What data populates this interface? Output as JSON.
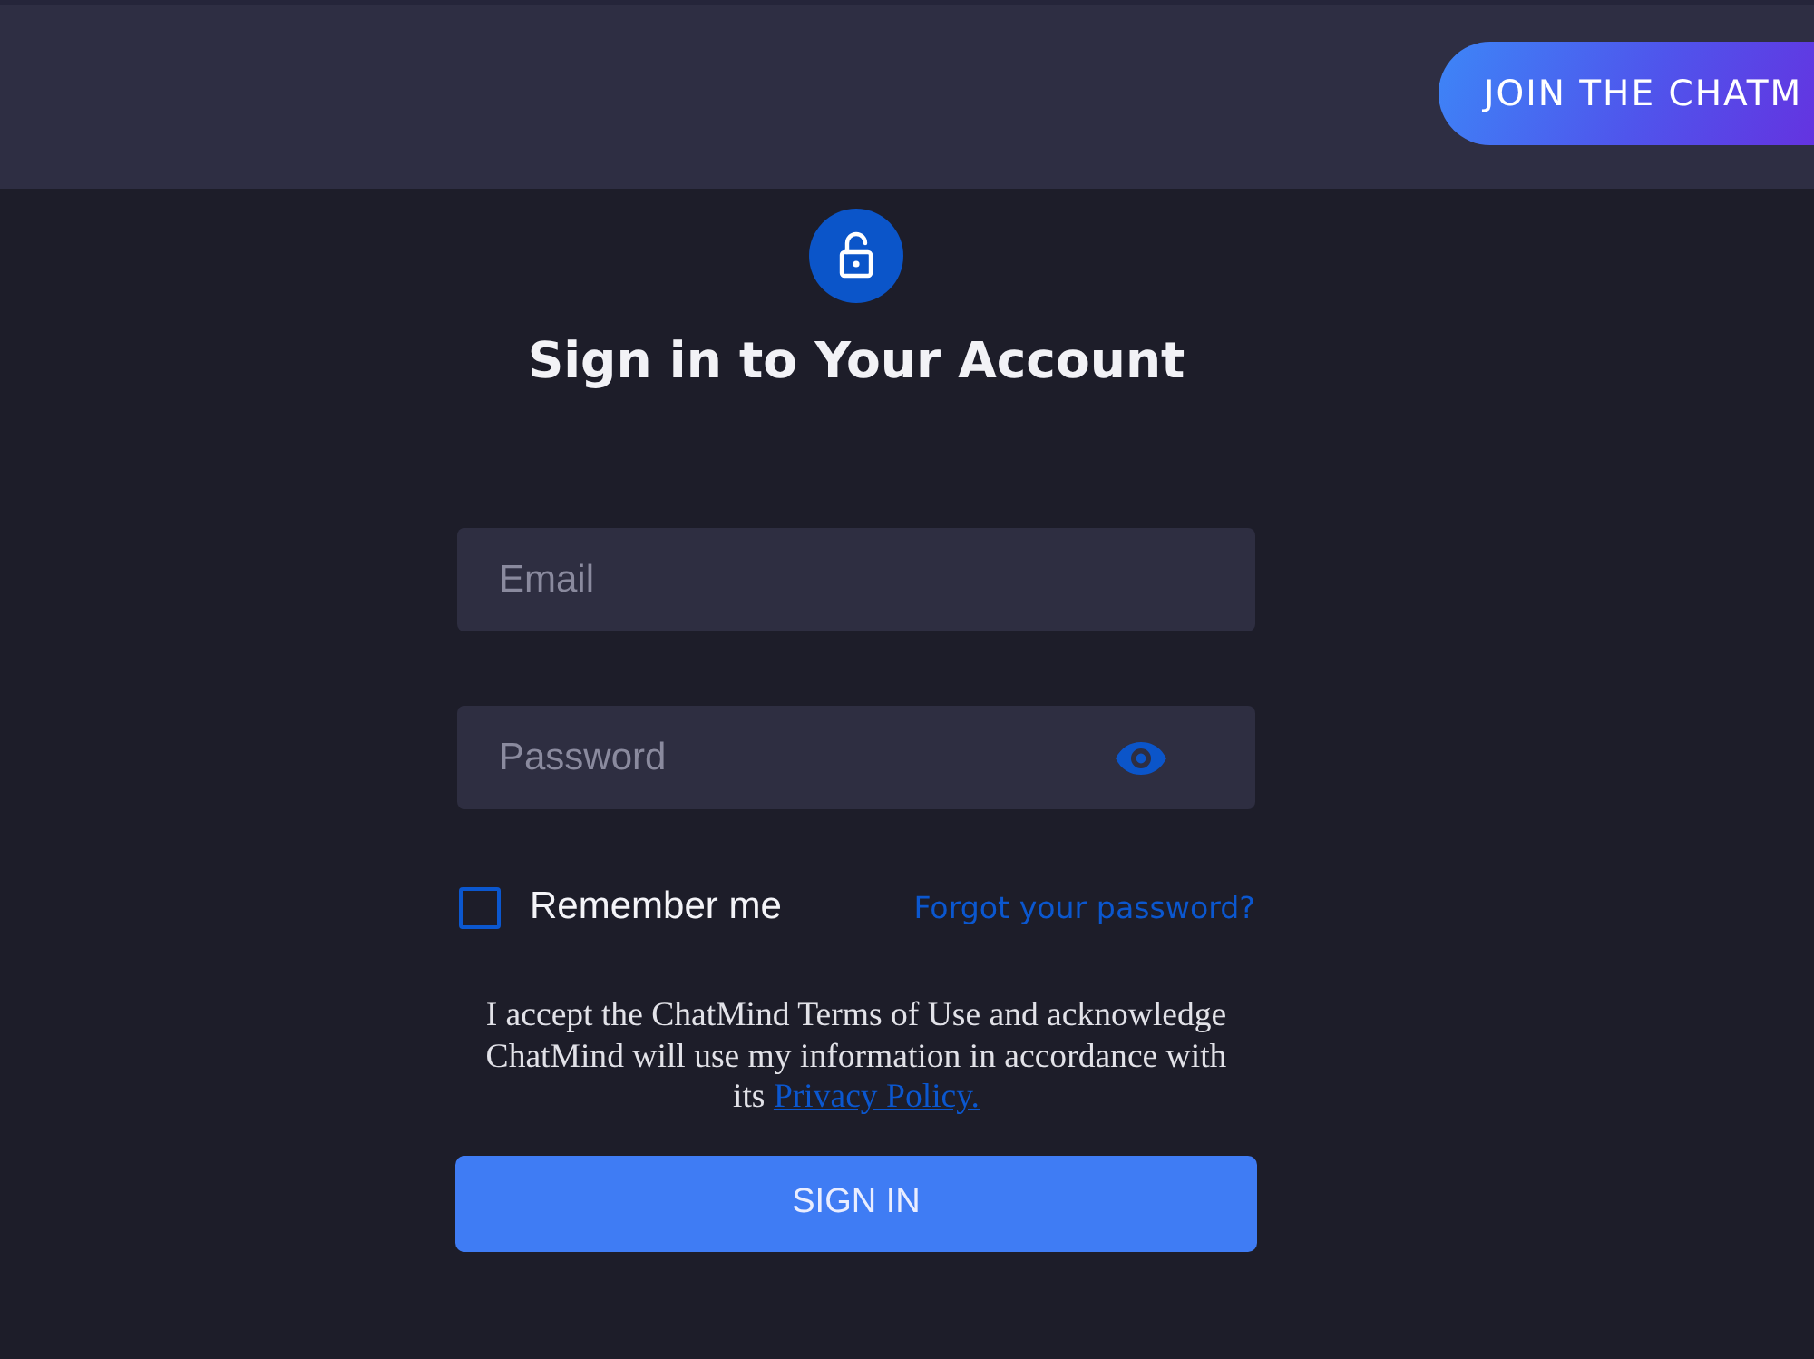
{
  "header": {
    "cta_button": "JOIN THE CHATM"
  },
  "form": {
    "title": "Sign in to Your Account",
    "fields": [
      {
        "kind": "email",
        "placeholder": "Email"
      },
      {
        "kind": "password",
        "placeholder": "Password"
      }
    ],
    "remember_me": {
      "label": "Remember me",
      "checked": false
    },
    "forgot_link": "Forgot your password?",
    "terms": {
      "text": "I accept the ChatMind Terms of Use and acknowledge ChatMind will use my information in accordance with its ",
      "link": "Privacy Policy."
    },
    "submit_button": "SIGN IN"
  }
}
